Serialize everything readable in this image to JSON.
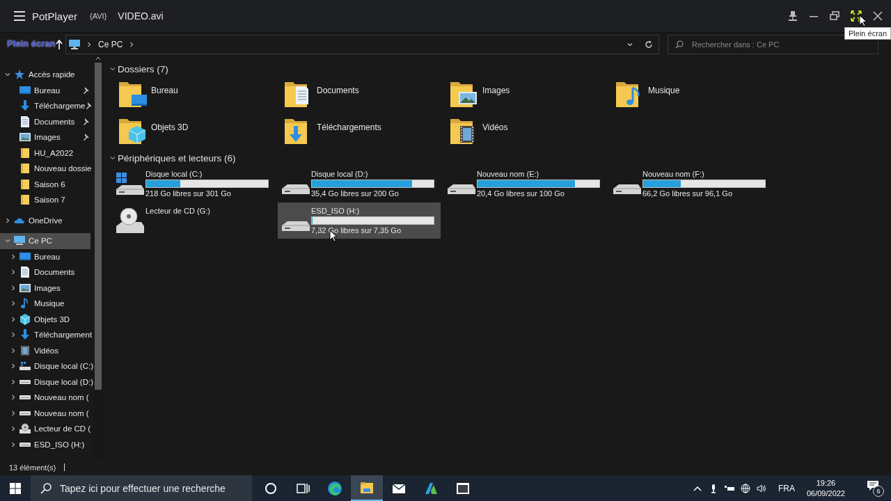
{
  "player": {
    "title": "PotPlayer",
    "format": "{AVI}",
    "file": "VIDEO.avi",
    "tooltip": "Plein écran",
    "osd_text": "Plein écran"
  },
  "explorer": {
    "address": {
      "crumbs": [
        "Ce PC"
      ]
    },
    "search": {
      "placeholder": "Rechercher dans : Ce PC"
    },
    "sidebar": {
      "items": [
        {
          "label": "Accès rapide",
          "kind": "star",
          "expanded": true,
          "selected": false,
          "children": [
            {
              "label": "Bureau",
              "kind": "desktop",
              "pinned": true,
              "selected": false
            },
            {
              "label": "Téléchargeme",
              "kind": "downloads",
              "pinned": true,
              "selected": false
            },
            {
              "label": "Documents",
              "kind": "documents",
              "pinned": true,
              "selected": false
            },
            {
              "label": "Images",
              "kind": "images",
              "pinned": true,
              "selected": false
            },
            {
              "label": "HU_A2022",
              "kind": "folder",
              "pinned": false,
              "selected": false
            },
            {
              "label": "Nouveau dossie",
              "kind": "folder",
              "pinned": false,
              "selected": false
            },
            {
              "label": "Saison 6",
              "kind": "folder",
              "pinned": false,
              "selected": false
            },
            {
              "label": "Saison 7",
              "kind": "folder",
              "pinned": false,
              "selected": false
            }
          ]
        },
        {
          "label": "OneDrive",
          "kind": "cloud",
          "expanded": false,
          "selected": false
        },
        {
          "label": "Ce PC",
          "kind": "pc",
          "expanded": true,
          "selected": true,
          "children": [
            {
              "label": "Bureau",
              "kind": "desktop",
              "expanded": false,
              "selected": false
            },
            {
              "label": "Documents",
              "kind": "documents",
              "expanded": false,
              "selected": false
            },
            {
              "label": "Images",
              "kind": "images",
              "expanded": false,
              "selected": false
            },
            {
              "label": "Musique",
              "kind": "music",
              "expanded": false,
              "selected": false
            },
            {
              "label": "Objets 3D",
              "kind": "cube",
              "expanded": false,
              "selected": false
            },
            {
              "label": "Téléchargement",
              "kind": "downloads",
              "expanded": false,
              "selected": false
            },
            {
              "label": "Vidéos",
              "kind": "videos",
              "expanded": false,
              "selected": false
            },
            {
              "label": "Disque local (C:)",
              "kind": "sysdrive",
              "expanded": false,
              "selected": false
            },
            {
              "label": "Disque local (D:)",
              "kind": "drive",
              "expanded": false,
              "selected": false
            },
            {
              "label": "Nouveau nom (",
              "kind": "drive",
              "expanded": false,
              "selected": false
            },
            {
              "label": "Nouveau nom (",
              "kind": "drive",
              "expanded": false,
              "selected": false
            },
            {
              "label": "Lecteur de CD (",
              "kind": "cd",
              "expanded": false,
              "selected": false
            },
            {
              "label": "ESD_ISO (H:)",
              "kind": "drive",
              "expanded": false,
              "selected": false
            }
          ]
        }
      ]
    },
    "sections": [
      {
        "title": "Dossiers (7)",
        "expanded": true,
        "items": [
          {
            "name": "Bureau",
            "kind": "desktop"
          },
          {
            "name": "Documents",
            "kind": "documents"
          },
          {
            "name": "Images",
            "kind": "images"
          },
          {
            "name": "Musique",
            "kind": "music"
          },
          {
            "name": "Objets 3D",
            "kind": "cube"
          },
          {
            "name": "Téléchargements",
            "kind": "downloads"
          },
          {
            "name": "Vidéos",
            "kind": "videos"
          }
        ]
      },
      {
        "title": "Périphériques et lecteurs (6)",
        "expanded": true,
        "items": [
          {
            "name": "Disque local (C:)",
            "kind": "sysdrive",
            "level": 0.28,
            "free": "218 Go libres sur 301 Go",
            "selected": false
          },
          {
            "name": "Disque local (D:)",
            "kind": "drive",
            "level": 0.82,
            "free": "35,4 Go libres sur 200 Go",
            "selected": false
          },
          {
            "name": "Nouveau nom (E:)",
            "kind": "drive",
            "level": 0.8,
            "free": "20,4 Go libres sur 100 Go",
            "selected": false
          },
          {
            "name": "Nouveau nom (F:)",
            "kind": "drive",
            "level": 0.31,
            "free": "66,2 Go libres sur 96,1 Go",
            "selected": false
          },
          {
            "name": "Lecteur de CD (G:)",
            "kind": "cd",
            "selected": false
          },
          {
            "name": "ESD_ISO (H:)",
            "kind": "drive",
            "level": 0.004,
            "free": "7,32 Go libres sur 7,35 Go",
            "selected": true
          }
        ]
      }
    ],
    "status_bar": {
      "count": "13 élément(s)"
    }
  },
  "taskbar": {
    "search": {
      "placeholder": "Tapez ici pour effectuer une recherche"
    },
    "apps": [
      {
        "kind": "cortana",
        "active": false
      },
      {
        "kind": "task-view",
        "active": false
      },
      {
        "kind": "browser",
        "active": false
      },
      {
        "kind": "explorer",
        "active": true
      },
      {
        "kind": "mail",
        "active": false
      },
      {
        "kind": "azure",
        "active": false
      },
      {
        "kind": "window",
        "active": false
      }
    ],
    "language": "FRA",
    "time": "19:26",
    "date": "06/09/2022",
    "notifications": "6"
  }
}
